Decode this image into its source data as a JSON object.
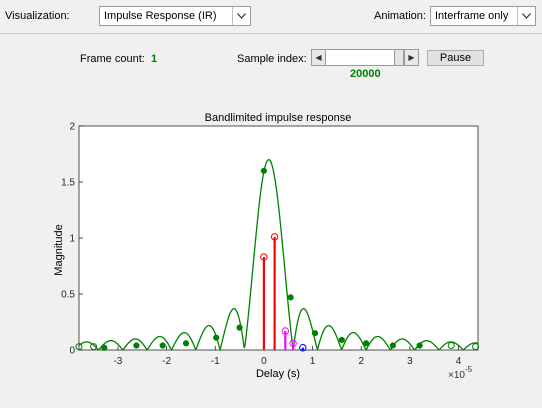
{
  "toolbar": {
    "visualization_label": "Visualization:",
    "visualization_value": "Impulse Response (IR)",
    "animation_label": "Animation:",
    "animation_value": "Interframe only"
  },
  "controls": {
    "frame_count_label": "Frame count:",
    "frame_count_value": "1",
    "sample_index_label": "Sample index:",
    "sample_index_value": "20000",
    "slider_left_arrow": "◀",
    "slider_right_arrow": "▶",
    "pause_label": "Pause"
  },
  "chart_data": {
    "type": "line",
    "title": "Bandlimited impulse response",
    "xlabel": "Delay (s)",
    "ylabel": "Magnitude",
    "x_scale_label": "×10",
    "x_scale_exponent": "-5",
    "xlim": [
      -3.8,
      4.4
    ],
    "ylim": [
      0,
      2
    ],
    "xticks": [
      -3,
      -2,
      -1,
      0,
      1,
      2,
      3,
      4
    ],
    "xtick_labels": [
      "-3",
      "-2",
      "-1",
      "0",
      "1",
      "2",
      "3",
      "4"
    ],
    "yticks": [
      0,
      0.5,
      1,
      1.5,
      2
    ],
    "ytick_labels": [
      "0",
      "0.5",
      "1",
      "1.5",
      "2"
    ],
    "grid": false,
    "colors": {
      "curve": "#008000",
      "stem_red": "#ff0000",
      "stem_magenta": "#ff00ff",
      "stem_blue": "#0000ff"
    },
    "curve": {
      "center": 0.1,
      "peak": 1.7,
      "sidelobe_period": 0.5
    },
    "filled_points": [
      {
        "x": -3.28,
        "y": 0.02
      },
      {
        "x": -2.62,
        "y": 0.04
      },
      {
        "x": -2.08,
        "y": 0.04
      },
      {
        "x": -1.6,
        "y": 0.06
      },
      {
        "x": -0.98,
        "y": 0.11
      },
      {
        "x": -0.5,
        "y": 0.2
      },
      {
        "x": 0.0,
        "y": 1.6
      },
      {
        "x": 0.55,
        "y": 0.47
      },
      {
        "x": 1.05,
        "y": 0.15
      },
      {
        "x": 1.6,
        "y": 0.09
      },
      {
        "x": 2.1,
        "y": 0.06
      },
      {
        "x": 2.65,
        "y": 0.04
      },
      {
        "x": 3.2,
        "y": 0.04
      }
    ],
    "open_points": [
      {
        "x": -3.8,
        "y": 0.03
      },
      {
        "x": -3.5,
        "y": 0.03
      },
      {
        "x": 3.85,
        "y": 0.04
      },
      {
        "x": 4.35,
        "y": 0.03
      }
    ],
    "stems": [
      {
        "x": 0.0,
        "y": 0.83,
        "color": "red"
      },
      {
        "x": 0.22,
        "y": 1.01,
        "color": "red"
      },
      {
        "x": 0.44,
        "y": 0.17,
        "color": "magenta"
      },
      {
        "x": 0.6,
        "y": 0.06,
        "color": "magenta"
      },
      {
        "x": 0.8,
        "y": 0.02,
        "color": "blue"
      }
    ]
  }
}
